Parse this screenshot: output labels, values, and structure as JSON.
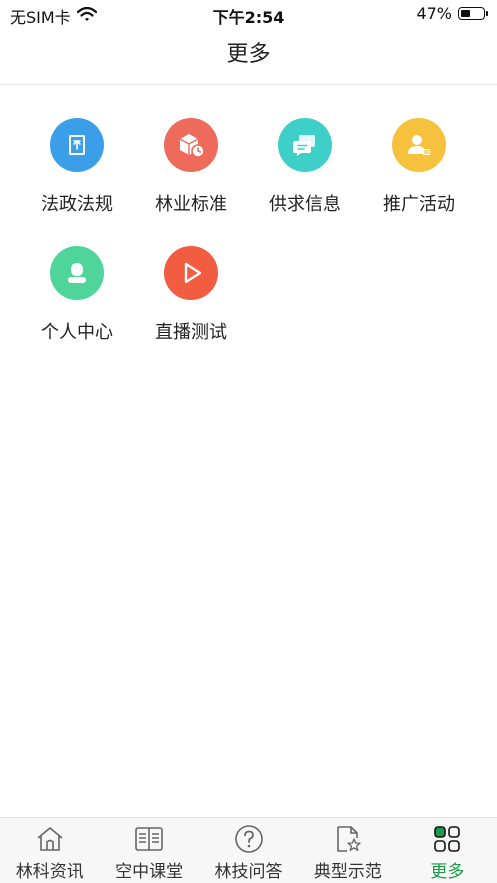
{
  "status_bar": {
    "carrier": "无SIM卡",
    "time": "下午2:54",
    "battery": "47%",
    "battery_level": 0.47
  },
  "nav": {
    "title": "更多"
  },
  "grid_items": [
    {
      "label": "法政法规",
      "icon": "law-book-icon",
      "color": "#3a9ee8"
    },
    {
      "label": "林业标准",
      "icon": "standard-box-icon",
      "color": "#ee6a5a"
    },
    {
      "label": "供求信息",
      "icon": "chat-bubbles-icon",
      "color": "#3ecfc8"
    },
    {
      "label": "推广活动",
      "icon": "promotion-user-icon",
      "color": "#f6c23e"
    },
    {
      "label": "个人中心",
      "icon": "person-icon",
      "color": "#4fd49a"
    },
    {
      "label": "直播测试",
      "icon": "play-icon",
      "color": "#f25c40"
    }
  ],
  "tabs": [
    {
      "label": "林科资讯",
      "icon": "home-icon"
    },
    {
      "label": "空中课堂",
      "icon": "book-icon"
    },
    {
      "label": "林技问答",
      "icon": "question-icon"
    },
    {
      "label": "典型示范",
      "icon": "document-star-icon"
    },
    {
      "label": "更多",
      "icon": "grid-icon",
      "active": true
    }
  ],
  "colors": {
    "accent": "#1a9b4a"
  }
}
